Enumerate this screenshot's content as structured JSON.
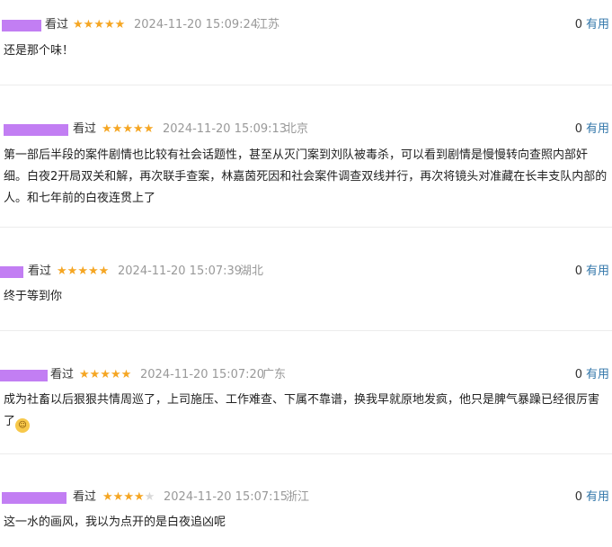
{
  "comments": [
    {
      "status": "看过",
      "stars": 5,
      "date": "2024-11-20 15:09:24",
      "location": "江苏",
      "votes": "0",
      "useful_label": "有用",
      "text": "还是那个味！"
    },
    {
      "status": "看过",
      "stars": 5,
      "date": "2024-11-20 15:09:13",
      "location": "北京",
      "votes": "0",
      "useful_label": "有用",
      "text": "第一部后半段的案件剧情也比较有社会话题性，甚至从灭门案到刘队被毒杀，可以看到剧情是慢慢转向查照内部奸细。白夜2开局双关和解，再次联手查案，林嘉茵死因和社会案件调查双线并行，再次将镜头对准藏在长丰支队内部的人。和七年前的白夜连贯上了"
    },
    {
      "status": "看过",
      "stars": 5,
      "date": "2024-11-20 15:07:39",
      "location": "湖北",
      "votes": "0",
      "useful_label": "有用",
      "text": "终于等到你"
    },
    {
      "status": "看过",
      "stars": 5,
      "date": "2024-11-20 15:07:20",
      "location": "广东",
      "votes": "0",
      "useful_label": "有用",
      "text": "成为社畜以后狠狠共情周巡了，上司施压、工作难查、下属不靠谱，换我早就原地发疯，他只是脾气暴躁已经很厉害了",
      "emoji": "grinning-sweat-emoji"
    },
    {
      "status": "看过",
      "stars": 4,
      "date": "2024-11-20 15:07:15",
      "location": "浙江",
      "votes": "0",
      "useful_label": "有用",
      "text": "这一水的画风，我以为点开的是白夜追凶呢"
    }
  ],
  "colors": {
    "username_redaction": "#c27ef3",
    "star_on": "#f5a623",
    "star_off": "#d9d9d9",
    "meta": "#999999",
    "useful_link": "#3377aa"
  }
}
